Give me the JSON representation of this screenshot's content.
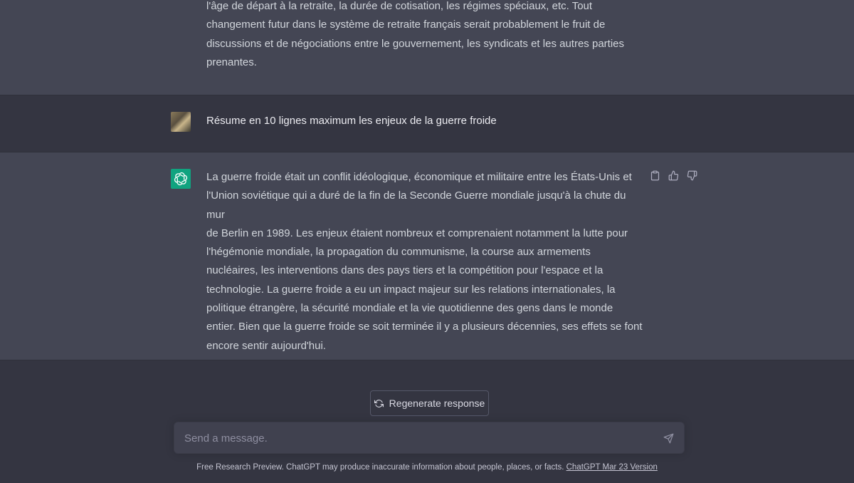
{
  "conversation": {
    "prev_response": {
      "lines": [
        "l'âge de départ à la retraite, la durée de cotisation, les régimes spéciaux, etc. Tout",
        "changement futur dans le système de retraite français serait probablement le fruit de",
        "discussions et de négociations entre le gouvernement, les syndicats et les autres parties",
        "prenantes."
      ]
    },
    "user_message": "Résume en 10 lignes maximum les enjeux de la guerre froide",
    "assistant_response": {
      "lines": [
        "La guerre froide était un conflit idéologique, économique et militaire entre les États-Unis et",
        "l'Union soviétique qui a duré de la fin de la Seconde Guerre mondiale jusqu'à la chute du mur",
        "de Berlin en 1989. Les enjeux étaient nombreux et comprenaient notamment la lutte pour",
        "l'hégémonie mondiale, la propagation du communisme, la course aux armements",
        "nucléaires, les interventions dans des pays tiers et la compétition pour l'espace et la",
        "technologie. La guerre froide a eu un impact majeur sur les relations internationales, la",
        "politique étrangère, la sécurité mondiale et la vie quotidienne des gens dans le monde",
        "entier. Bien que la guerre froide se soit terminée il y a plusieurs décennies, ses effets se font",
        "encore sentir aujourd'hui."
      ]
    }
  },
  "actions": {
    "icons": [
      "clipboard-icon",
      "thumbs-up-icon",
      "thumbs-down-icon"
    ]
  },
  "regenerate": {
    "label": "Regenerate response",
    "icon": "refresh-icon"
  },
  "composer": {
    "placeholder": "Send a message.",
    "value": "",
    "send_icon": "send-icon"
  },
  "footer": {
    "text": "Free Research Preview. ChatGPT may produce inaccurate information about people, places, or facts.",
    "link": "ChatGPT Mar 23 Version"
  },
  "colors": {
    "background": "#343541",
    "assistant_background": "#444654",
    "brand": "#10a37f",
    "input_background": "#40414f"
  }
}
